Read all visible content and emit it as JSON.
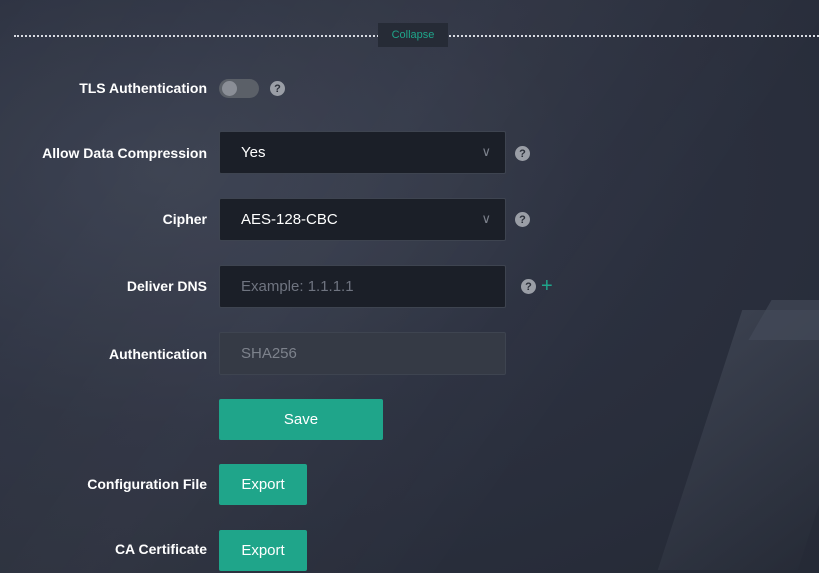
{
  "divider": {
    "collapse_label": "Collapse"
  },
  "tls_auth": {
    "label": "TLS Authentication",
    "enabled": false,
    "help": "?"
  },
  "compression": {
    "label": "Allow Data Compression",
    "value": "Yes",
    "help": "?"
  },
  "cipher": {
    "label": "Cipher",
    "value": "AES-128-CBC",
    "help": "?"
  },
  "deliver_dns": {
    "label": "Deliver DNS",
    "value": "",
    "placeholder": "Example: 1.1.1.1",
    "help": "?",
    "add_symbol": "+"
  },
  "authentication": {
    "label": "Authentication",
    "value": "SHA256"
  },
  "save_label": "Save",
  "config_file": {
    "label": "Configuration File",
    "button": "Export"
  },
  "ca_cert": {
    "label": "CA Certificate",
    "button": "Export"
  },
  "colors": {
    "accent": "#1fa58a",
    "background": "#2c3140",
    "field": "#1b1f28"
  }
}
